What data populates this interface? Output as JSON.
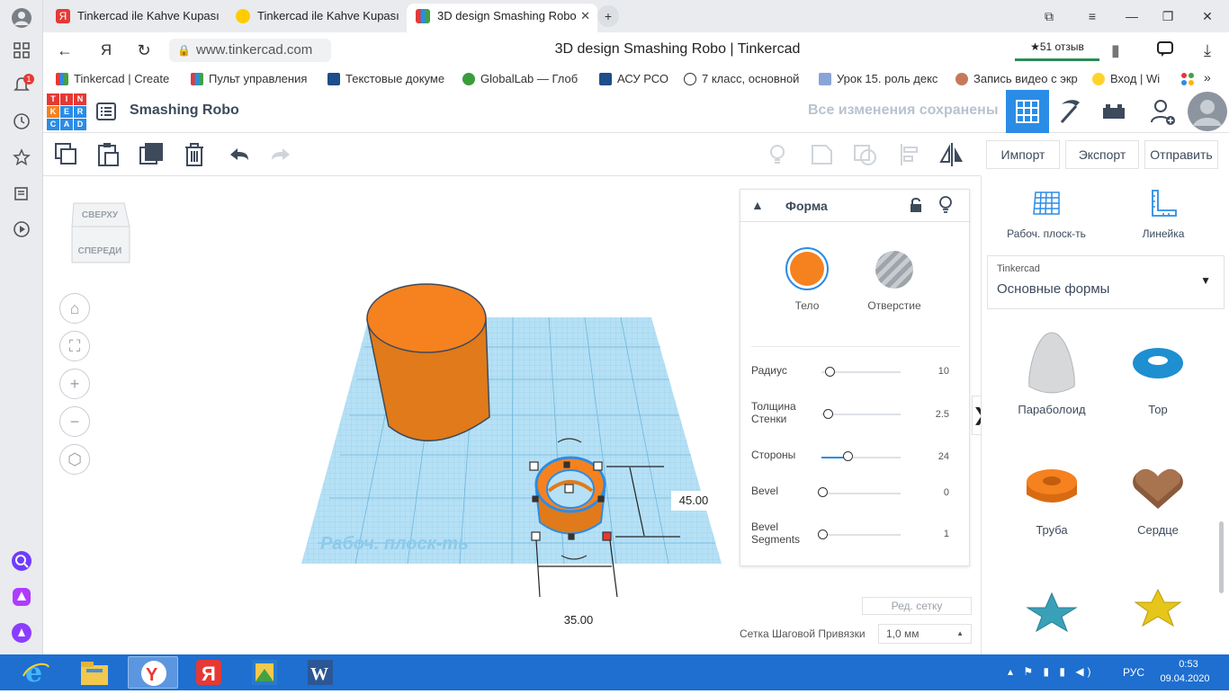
{
  "browser": {
    "tabs": [
      {
        "title": "Tinkercad ile Kahve Kupası",
        "active": false
      },
      {
        "title": "Tinkercad ile Kahve Kupası",
        "active": false
      },
      {
        "title": "3D design Smashing Robo",
        "active": true
      }
    ],
    "address": {
      "url": "www.tinkercad.com",
      "title": "3D design Smashing Robo | Tinkercad",
      "reviews": "★51 отзыв"
    },
    "notification_badge": "1",
    "bookmarks": [
      {
        "label": "Tinkercad | Create"
      },
      {
        "label": "Пульт управления"
      },
      {
        "label": "Текстовые докуме"
      },
      {
        "label": "GlobalLab — Глоб"
      },
      {
        "label": "АСУ РСО"
      },
      {
        "label": "7 класс, основной"
      },
      {
        "label": "Урок 15. роль декс"
      },
      {
        "label": "Запись видео с экр"
      },
      {
        "label": "Вход | Wi"
      }
    ]
  },
  "header": {
    "logo_letters": [
      "T",
      "I",
      "N",
      "K",
      "E",
      "R",
      "C",
      "A",
      "D"
    ],
    "project_name": "Smashing Robo",
    "saved_status": "Все изменения сохранены"
  },
  "toolbar": {
    "import_label": "Импорт",
    "export_label": "Экспорт",
    "send_label": "Отправить"
  },
  "viewcube": {
    "top": "СВЕРХУ",
    "front": "СПЕРЕДИ"
  },
  "workplane_watermark": "Рабоч. плоск-ть",
  "dimensions": {
    "height": "45.00",
    "width": "35.00"
  },
  "shape_panel": {
    "title": "Форма",
    "solid_label": "Тело",
    "hole_label": "Отверстие",
    "params": [
      {
        "name": "Радиус",
        "value": "10"
      },
      {
        "name": "Толщина Стенки",
        "value": "2.5"
      },
      {
        "name": "Стороны",
        "value": "24"
      },
      {
        "name": "Bevel",
        "value": "0"
      },
      {
        "name": "Bevel Segments",
        "value": "1"
      }
    ]
  },
  "grid": {
    "edit_grid_label": "Ред. сетку",
    "snap_label": "Сетка Шаговой Привязки",
    "snap_value": "1,0 мм"
  },
  "right_panel": {
    "workplane_label": "Рабоч. плоск-ть",
    "ruler_label": "Линейка",
    "library_source": "Tinkercad",
    "library_name": "Основные формы",
    "shapes": [
      {
        "name": "Параболоид"
      },
      {
        "name": "Тор"
      },
      {
        "name": "Труба"
      },
      {
        "name": "Сердце"
      }
    ]
  },
  "taskbar": {
    "lang": "РУС",
    "time": "0:53",
    "date": "09.04.2020"
  },
  "colors": {
    "solid": "#f5821f",
    "accent": "#2b8ce6",
    "grid": "#b6e0f5"
  }
}
